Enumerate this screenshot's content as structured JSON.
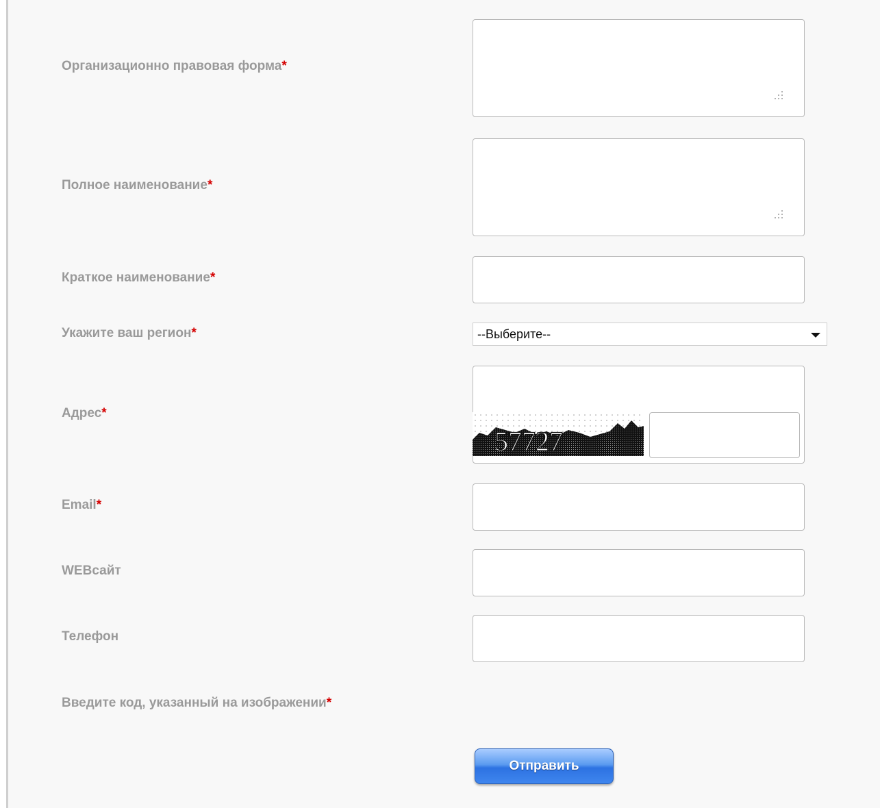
{
  "form": {
    "required_mark": "*",
    "legal_form": {
      "label": "Организационно правовая форма",
      "value": ""
    },
    "full_name": {
      "label": "Полное наименование",
      "value": ""
    },
    "short_name": {
      "label": "Краткое наименование",
      "value": ""
    },
    "region": {
      "label": "Укажите ваш регион",
      "selected": "--Выберите--"
    },
    "address": {
      "label": "Адрес",
      "value": ""
    },
    "email": {
      "label": "Email",
      "value": ""
    },
    "website": {
      "label": "WEBсайт",
      "value": ""
    },
    "phone": {
      "label": "Телефон",
      "value": ""
    },
    "captcha": {
      "label": "Введите код, указанный на изображении",
      "code": "57727",
      "value": ""
    },
    "submit_label": "Отправить"
  },
  "colors": {
    "panel_bg": "#f8f8f8",
    "label_text": "#9a9a9a",
    "required": "#d40000",
    "button_blue": "#2d72e2"
  },
  "icons": {
    "resize_grip": "resize-grip-icon",
    "dropdown_arrow": "chevron-down-icon"
  }
}
